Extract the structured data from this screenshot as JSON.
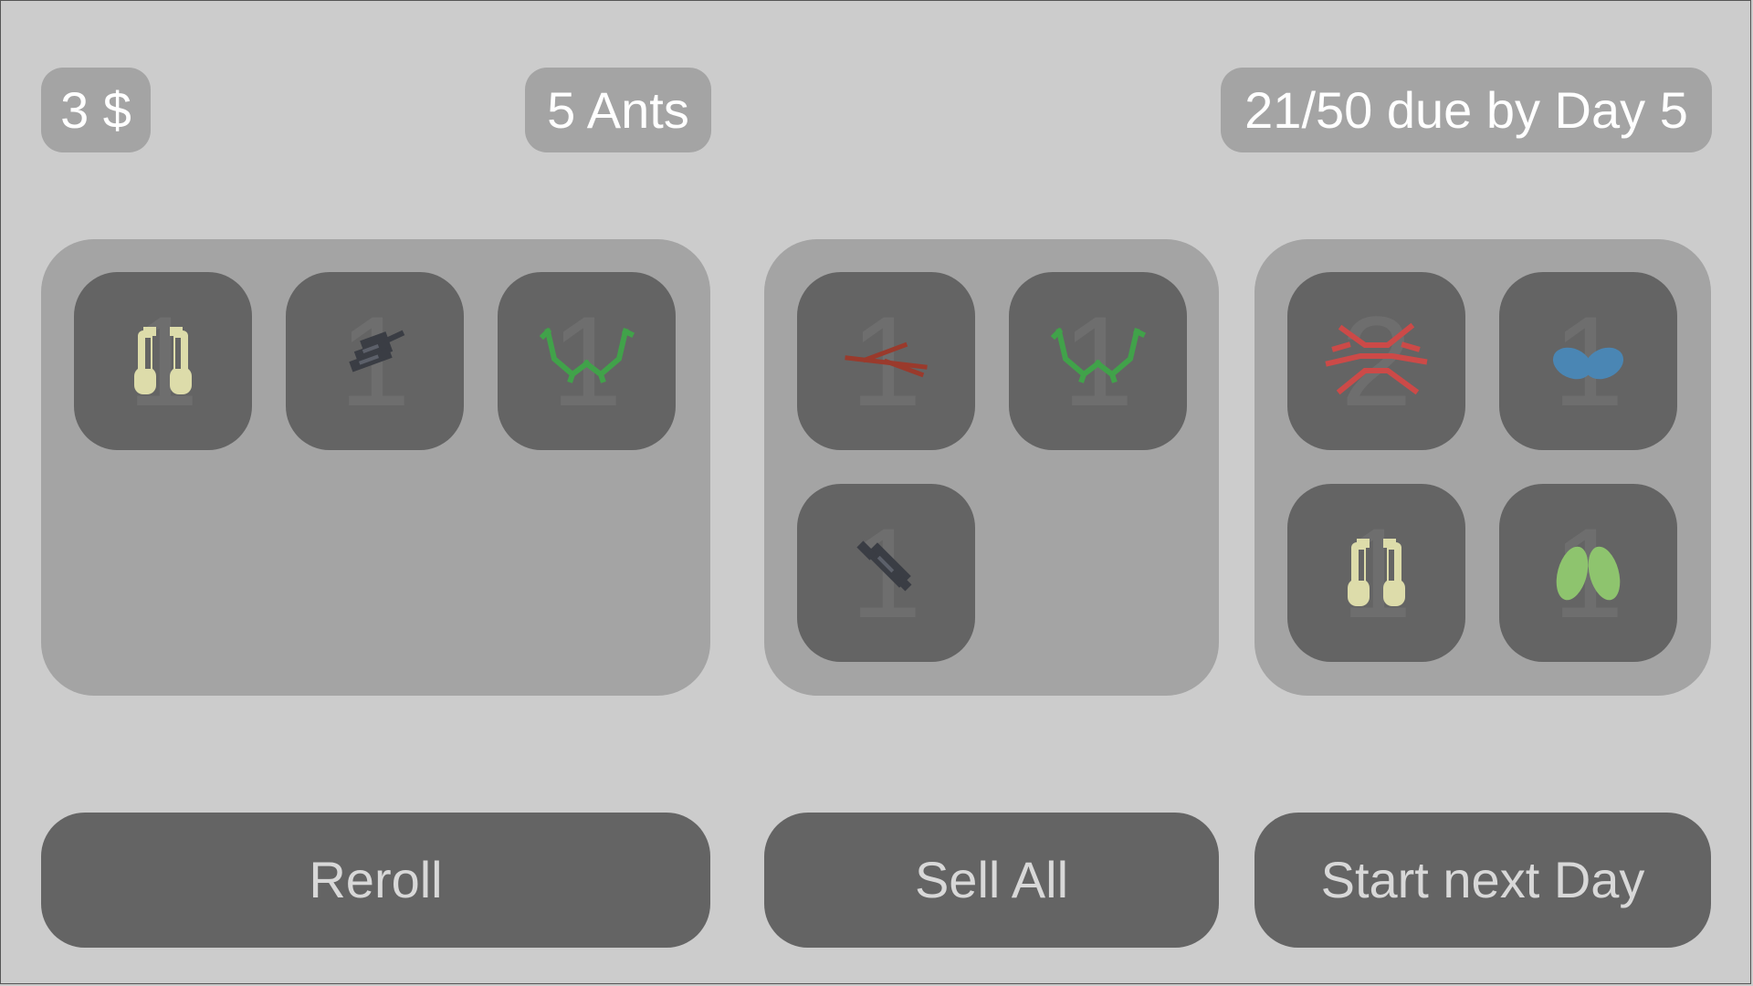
{
  "header": {
    "money": "3 $",
    "ants": "5 Ants",
    "quota": "21/50 due by Day 5"
  },
  "panels": [
    {
      "name": "shop",
      "slots": [
        {
          "count": "1",
          "icon": "pale-mandibles-icon",
          "color": "#dddcaa"
        },
        {
          "count": "1",
          "icon": "dark-beetle-icon",
          "color": "#3a3d44"
        },
        {
          "count": "1",
          "icon": "green-antennae-icon",
          "color": "#41a24a"
        }
      ]
    },
    {
      "name": "inventory",
      "slots": [
        {
          "count": "1",
          "icon": "red-stick-icon",
          "color": "#9a3a2c"
        },
        {
          "count": "1",
          "icon": "green-antennae-icon",
          "color": "#41a24a"
        },
        {
          "count": "1",
          "icon": "dark-bug-icon",
          "color": "#3a3d44"
        }
      ]
    },
    {
      "name": "equipped",
      "slots": [
        {
          "count": "2",
          "icon": "red-legs-icon",
          "color": "#cc4a48"
        },
        {
          "count": "1",
          "icon": "blue-wings-icon",
          "color": "#4a86b4"
        },
        {
          "count": "1",
          "icon": "pale-mandibles-icon",
          "color": "#dddcaa"
        },
        {
          "count": "1",
          "icon": "green-wings-icon",
          "color": "#8ec46e"
        }
      ]
    }
  ],
  "buttons": {
    "reroll": "Reroll",
    "sell_all": "Sell All",
    "start_next_day": "Start next Day"
  }
}
